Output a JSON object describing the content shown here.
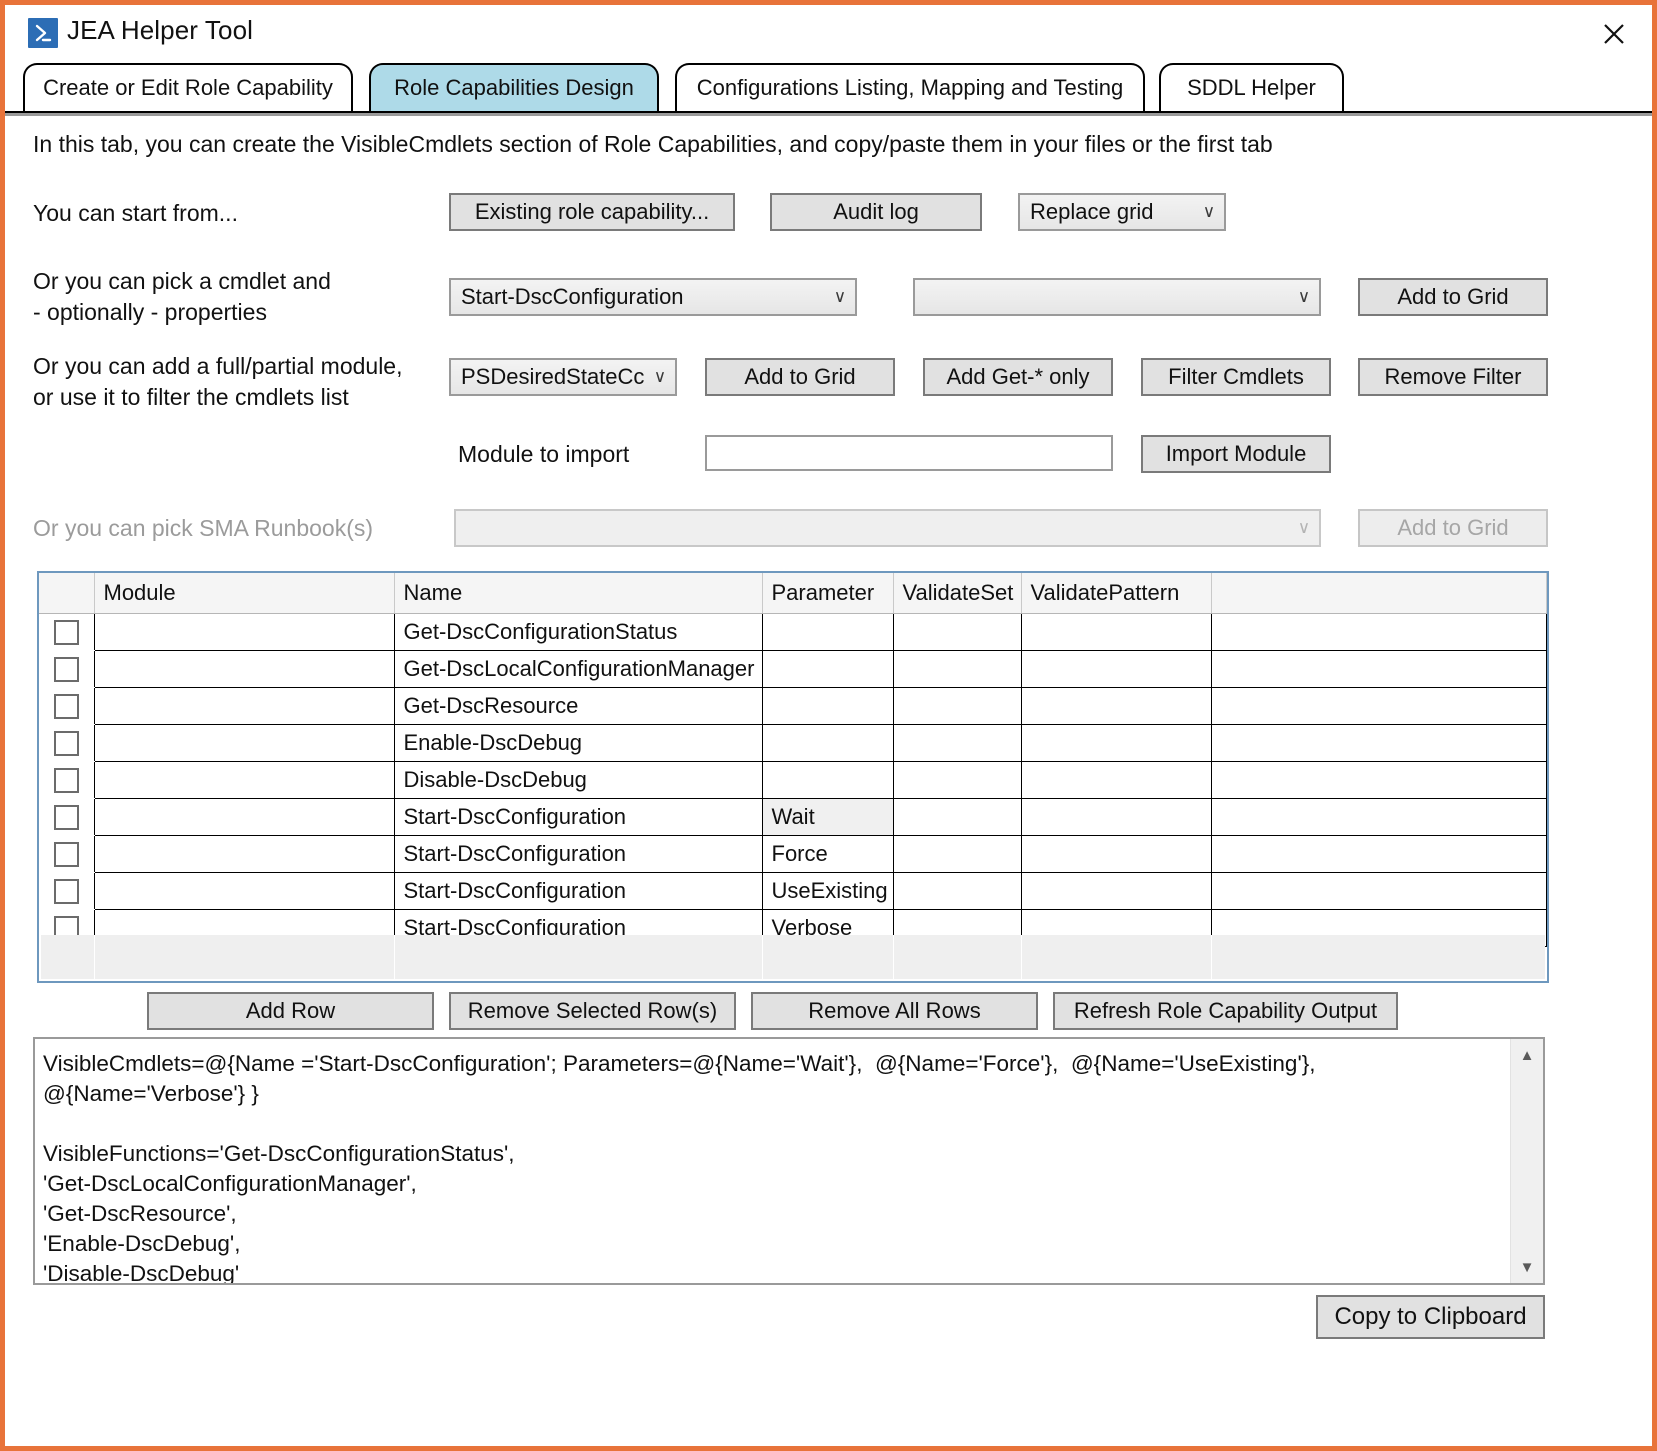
{
  "window": {
    "title": "JEA Helper Tool",
    "logo_icon": "powershell-icon",
    "close_icon": "close-icon",
    "accent_border": "#E8733A"
  },
  "tabs": [
    {
      "label": "Create or Edit Role Capability",
      "selected": false
    },
    {
      "label": "Role Capabilities Design",
      "selected": true
    },
    {
      "label": "Configurations Listing, Mapping and Testing",
      "selected": false
    },
    {
      "label": "SDDL Helper",
      "selected": false
    }
  ],
  "description": "In this tab, you can create the VisibleCmdlets section of Role Capabilities, and copy/paste them in your files or the first tab",
  "start_from": {
    "label": "You can start from...",
    "existing_role_capability_button": "Existing role capability...",
    "audit_log_button": "Audit log",
    "mode_combo_value": "Replace grid"
  },
  "cmdlet_picker": {
    "label_line1": "Or you can pick a cmdlet and",
    "label_line2": "- optionally - properties",
    "cmdlet_combo_value": "Start-DscConfiguration",
    "property_combo_value": "",
    "add_to_grid_button": "Add to Grid"
  },
  "module_picker": {
    "label_line1": "Or you can add a full/partial module,",
    "label_line2": "or use it to filter the cmdlets list",
    "module_combo_value": "PSDesiredStateCc",
    "add_to_grid_button": "Add to Grid",
    "add_get_only_button": "Add Get-* only",
    "filter_cmdlets_button": "Filter Cmdlets",
    "remove_filter_button": "Remove Filter"
  },
  "module_import": {
    "label": "Module to import",
    "input_value": "",
    "import_button": "Import Module"
  },
  "sma_runbook": {
    "label": "Or you can pick SMA Runbook(s)",
    "combo_value": "",
    "add_to_grid_button": "Add to Grid",
    "disabled": true
  },
  "grid": {
    "columns": [
      "",
      "Module",
      "Name",
      "Parameter",
      "ValidateSet",
      "ValidatePattern",
      ""
    ],
    "rows": [
      {
        "checked": false,
        "module": "",
        "name": "Get-DscConfigurationStatus",
        "parameter": "",
        "validateset": "",
        "validatepattern": "",
        "param_selected": false
      },
      {
        "checked": false,
        "module": "",
        "name": "Get-DscLocalConfigurationManager",
        "parameter": "",
        "validateset": "",
        "validatepattern": "",
        "param_selected": false
      },
      {
        "checked": false,
        "module": "",
        "name": "Get-DscResource",
        "parameter": "",
        "validateset": "",
        "validatepattern": "",
        "param_selected": false
      },
      {
        "checked": false,
        "module": "",
        "name": "Enable-DscDebug",
        "parameter": "",
        "validateset": "",
        "validatepattern": "",
        "param_selected": false
      },
      {
        "checked": false,
        "module": "",
        "name": "Disable-DscDebug",
        "parameter": "",
        "validateset": "",
        "validatepattern": "",
        "param_selected": false
      },
      {
        "checked": false,
        "module": "",
        "name": "Start-DscConfiguration",
        "parameter": "Wait",
        "validateset": "",
        "validatepattern": "",
        "param_selected": true
      },
      {
        "checked": false,
        "module": "",
        "name": "Start-DscConfiguration",
        "parameter": "Force",
        "validateset": "",
        "validatepattern": "",
        "param_selected": false
      },
      {
        "checked": false,
        "module": "",
        "name": "Start-DscConfiguration",
        "parameter": "UseExisting",
        "validateset": "",
        "validatepattern": "",
        "param_selected": false
      },
      {
        "checked": false,
        "module": "",
        "name": "Start-DscConfiguration",
        "parameter": "Verbose",
        "validateset": "",
        "validatepattern": "",
        "param_selected": false
      }
    ]
  },
  "grid_actions": {
    "add_row_button": "Add Row",
    "remove_selected_button": "Remove Selected Row(s)",
    "remove_all_button": "Remove All Rows",
    "refresh_button": "Refresh Role Capability Output"
  },
  "output": {
    "text": "VisibleCmdlets=@{Name ='Start-DscConfiguration'; Parameters=@{Name='Wait'},  @{Name='Force'},  @{Name='UseExisting'},  @{Name='Verbose'} }\n\nVisibleFunctions='Get-DscConfigurationStatus',\n'Get-DscLocalConfigurationManager',\n'Get-DscResource',\n'Enable-DscDebug',\n'Disable-DscDebug'",
    "scroll_up_icon": "chevron-up-icon",
    "scroll_down_icon": "chevron-down-icon"
  },
  "footer": {
    "copy_button": "Copy to Clipboard"
  }
}
